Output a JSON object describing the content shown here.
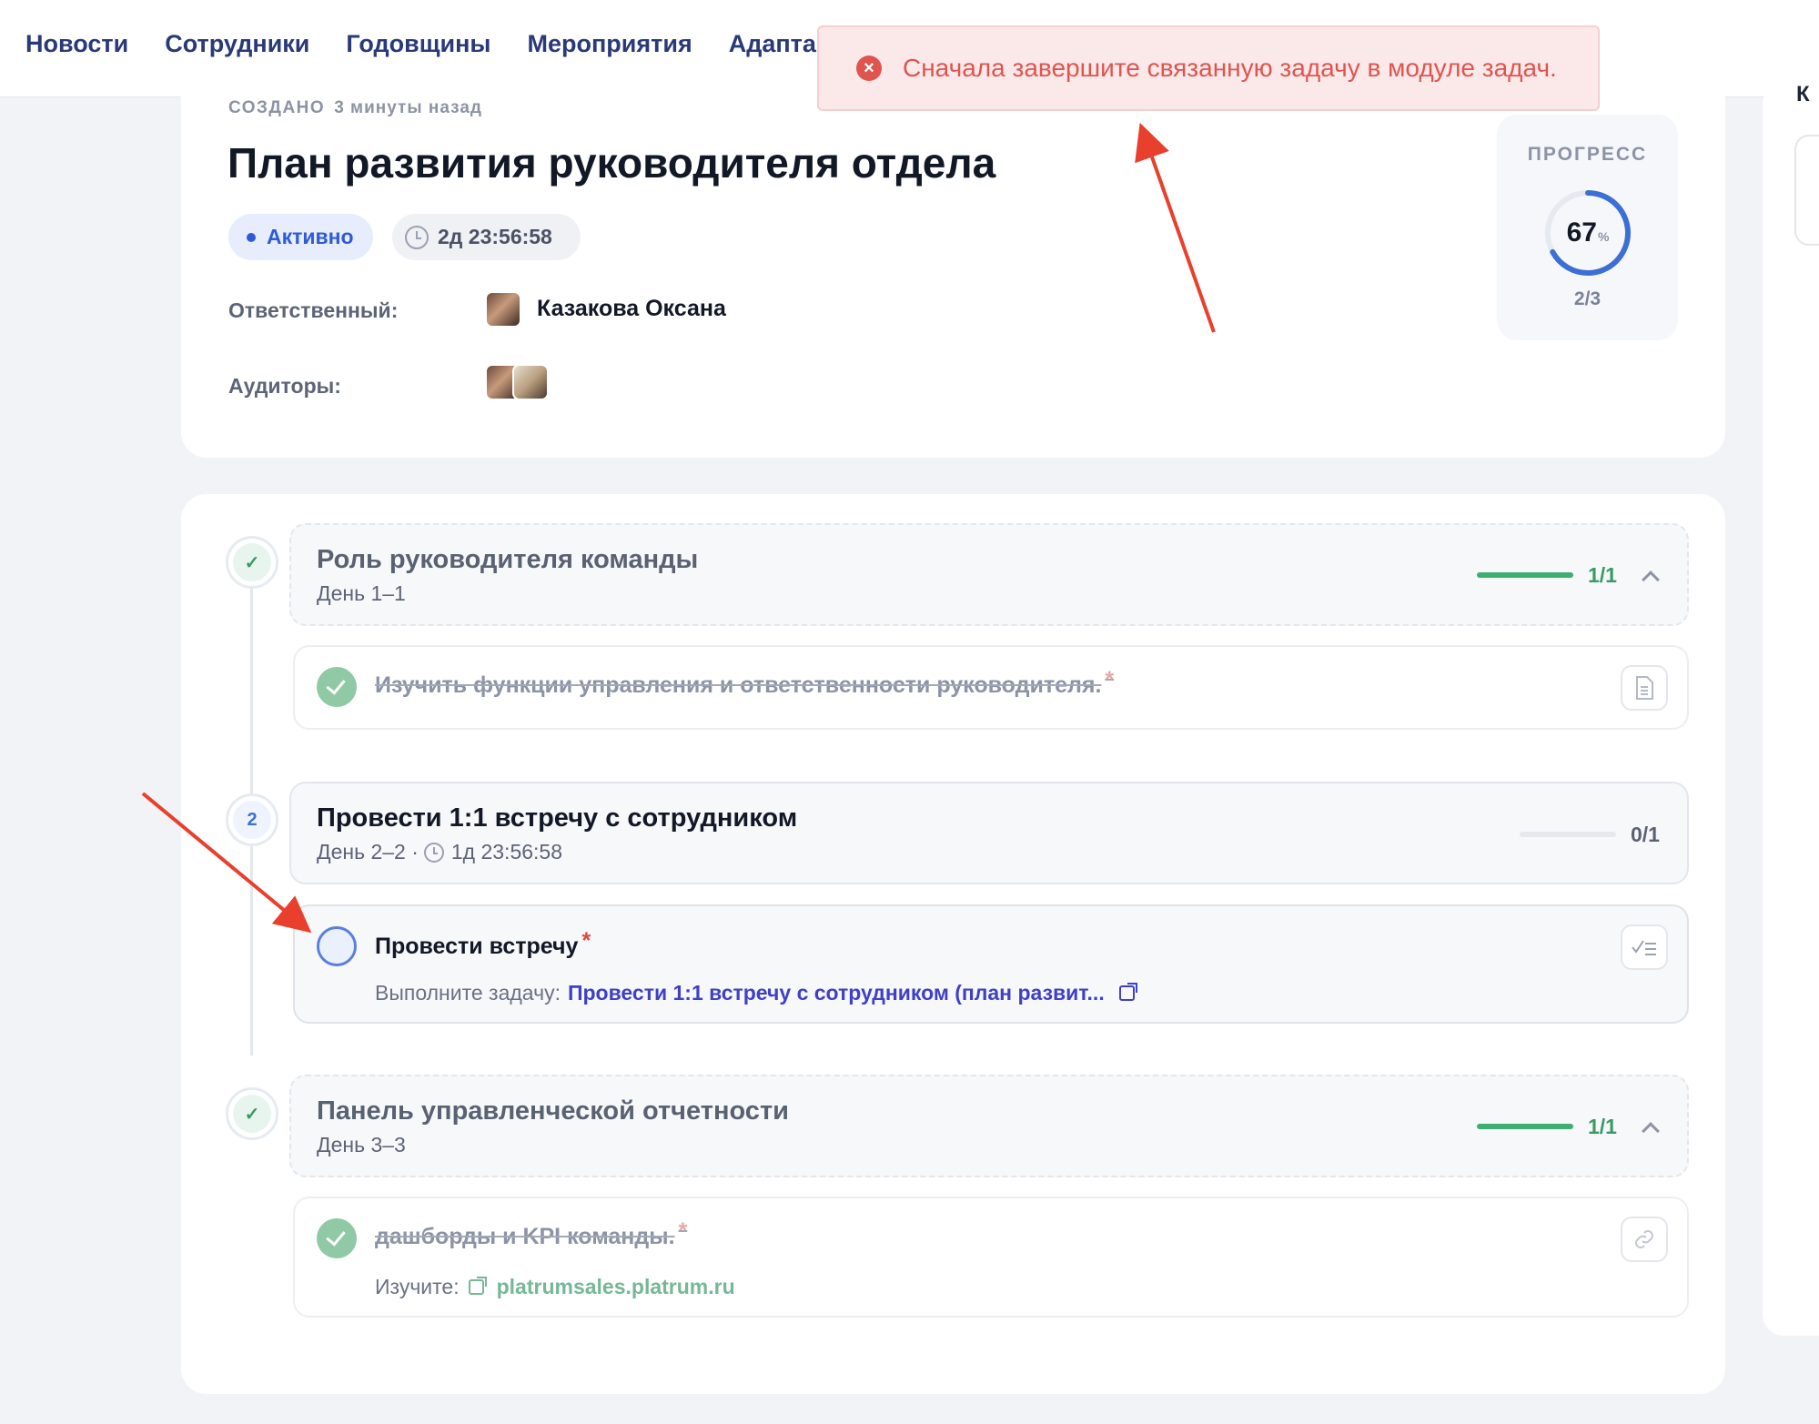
{
  "nav": {
    "items": [
      "Новости",
      "Сотрудники",
      "Годовщины",
      "Мероприятия",
      "Адаптац"
    ]
  },
  "side_panel": {
    "peek_text": "К"
  },
  "toast": {
    "icon": "error-x-icon",
    "message": "Сначала завершите связанную задачу в модуле задач."
  },
  "header": {
    "created_label": "СОЗДАНО",
    "created_ago": "3 минуты назад",
    "title": "План развития руководителя отдела",
    "status": "Активно",
    "timer": "2д 23:56:58",
    "owner_label": "Ответственный:",
    "owner_name": "Казакова Оксана",
    "auditors_label": "Аудиторы:"
  },
  "progress": {
    "label": "ПРОГРЕСС",
    "percent": 67,
    "percent_sign": "%",
    "count": "2/3"
  },
  "steps": [
    {
      "marker": "check",
      "title": "Роль руководителя команды",
      "days": "День 1–1",
      "count": "1/1",
      "progress": 1.0,
      "task": {
        "title": "Изучить функции управления и ответственности руководителя.",
        "required_mark": "*",
        "done": true,
        "icon": "document-icon"
      }
    },
    {
      "marker": "2",
      "title": "Провести 1:1 встречу с сотрудником",
      "days": "День 2–2 ·",
      "timer": "1д 23:56:58",
      "count": "0/1",
      "progress": 0.0,
      "task": {
        "title": "Провести встречу",
        "required_mark": "*",
        "done": false,
        "icon": "checklist-icon",
        "meta_label": "Выполните задачу:",
        "meta_link": "Провести 1:1 встречу с сотрудником (план развит..."
      }
    },
    {
      "marker": "check",
      "title": "Панель управленческой отчетности",
      "days": "День 3–3",
      "count": "1/1",
      "progress": 1.0,
      "task": {
        "title": "дашборды и KPI команды.",
        "required_mark": "*",
        "done": true,
        "icon": "link-icon",
        "meta_label": "Изучите:",
        "meta_link": "platrumsales.platrum.ru"
      }
    }
  ],
  "colors": {
    "accent": "#2f5bd6",
    "success": "#3a9a66",
    "error": "#e0544e",
    "annotation_arrow": "#e8402c"
  }
}
